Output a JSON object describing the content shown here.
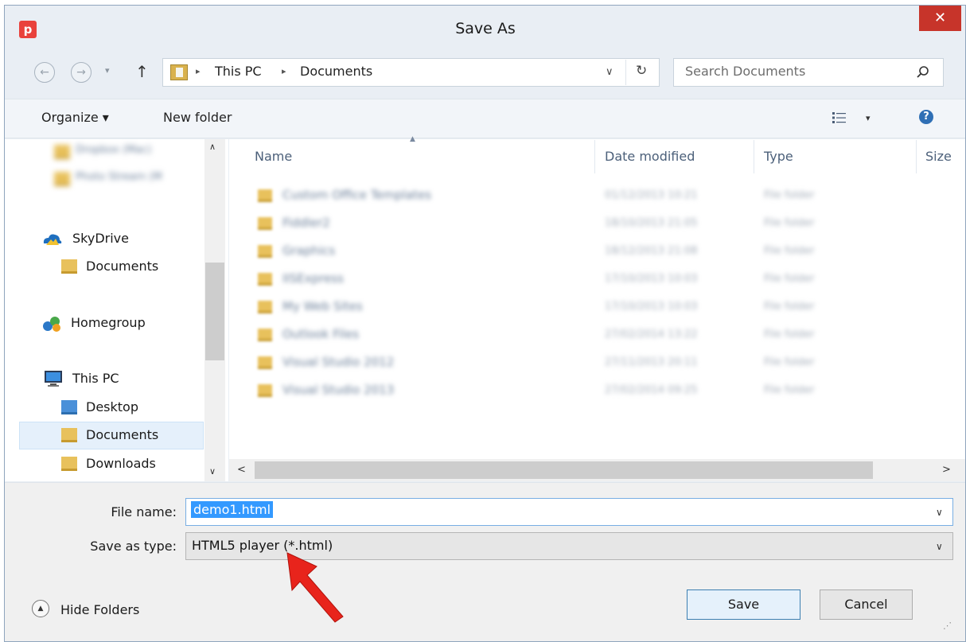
{
  "window": {
    "title": "Save As",
    "app_icon_letter": "p",
    "close_glyph": "✕"
  },
  "nav": {
    "back_glyph": "←",
    "forward_glyph": "→",
    "recent_glyph": "▾",
    "up_glyph": "↑",
    "breadcrumbs": [
      "This PC",
      "Documents"
    ],
    "separator": "▸",
    "dropdown_glyph": "∨",
    "refresh_glyph": "↻",
    "search_placeholder": "Search Documents"
  },
  "toolbar": {
    "organize": "Organize ▾",
    "new_folder": "New folder",
    "view_dropdown": "▾",
    "help": "?"
  },
  "sidebar": {
    "scroll_up": "∧",
    "scroll_down": "∨",
    "items": [
      {
        "label": "Dropbox (Mac)",
        "blurred": true
      },
      {
        "label": "Photo Stream (M",
        "blurred": true
      },
      {
        "label": "SkyDrive",
        "icon": "skydrive-icon"
      },
      {
        "label": "Documents",
        "icon": "folder-icon"
      },
      {
        "label": "Homegroup",
        "icon": "homegroup-icon"
      },
      {
        "label": "This PC",
        "icon": "computer-icon"
      },
      {
        "label": "Desktop",
        "icon": "desktop-folder-icon"
      },
      {
        "label": "Documents",
        "icon": "documents-folder-icon",
        "selected": true
      },
      {
        "label": "Downloads",
        "icon": "downloads-folder-icon"
      }
    ]
  },
  "filelist": {
    "columns": [
      "Name",
      "Date modified",
      "Type",
      "Size"
    ],
    "sort_glyph": "▲",
    "rows": [
      {
        "name": "Custom Office Templates",
        "date": "01/12/2013 10:21",
        "type": "File folder"
      },
      {
        "name": "Fiddler2",
        "date": "18/10/2013 21:05",
        "type": "File folder"
      },
      {
        "name": "Graphics",
        "date": "18/12/2013 21:08",
        "type": "File folder"
      },
      {
        "name": "IISExpress",
        "date": "17/10/2013 10:03",
        "type": "File folder"
      },
      {
        "name": "My Web Sites",
        "date": "17/10/2013 10:03",
        "type": "File folder"
      },
      {
        "name": "Outlook Files",
        "date": "27/02/2014 13:22",
        "type": "File folder"
      },
      {
        "name": "Visual Studio 2012",
        "date": "27/11/2013 20:11",
        "type": "File folder"
      },
      {
        "name": "Visual Studio 2013",
        "date": "27/02/2014 09:25",
        "type": "File folder"
      }
    ],
    "hscroll_left": "<",
    "hscroll_right": ">"
  },
  "form": {
    "filename_label": "File name:",
    "filename_value": "demo1.html",
    "savetype_label": "Save as type:",
    "savetype_value": "HTML5 player (*.html)",
    "dropdown_glyph": "∨"
  },
  "footer": {
    "hide_folders": "Hide Folders",
    "hide_folders_glyph": "▲",
    "save": "Save",
    "cancel": "Cancel",
    "grip": "⋰"
  },
  "colors": {
    "accent": "#3399ff",
    "close": "#c7342a",
    "annotation_arrow": "#e8241c"
  }
}
